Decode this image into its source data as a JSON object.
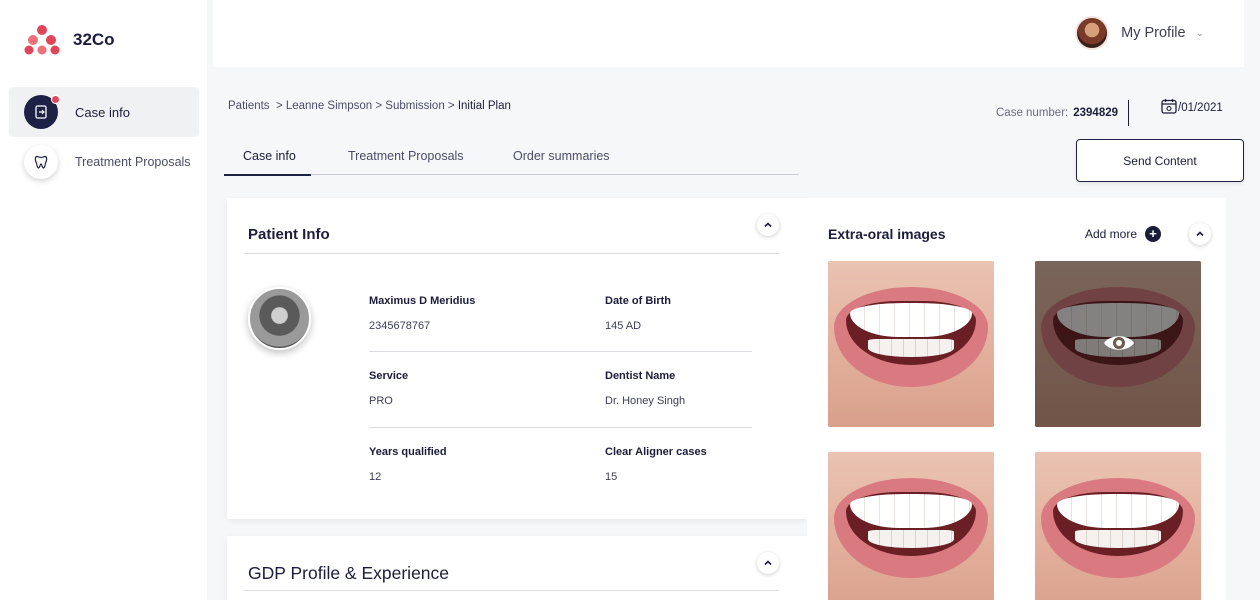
{
  "app": {
    "name": "32Co"
  },
  "sidebar": {
    "items": [
      {
        "label": "Case info",
        "active": true
      },
      {
        "label": "Treatment Proposals",
        "active": false
      }
    ]
  },
  "header": {
    "profile_label": "My Profile"
  },
  "breadcrumb": {
    "path": "Patients  > Leanne Simpson > Submission > ",
    "current": "Initial Plan"
  },
  "case": {
    "number_label": "Case number:",
    "number": "2394829",
    "date": "/01/2021"
  },
  "tabs": [
    {
      "label": "Case info",
      "active": true
    },
    {
      "label": "Treatment Proposals",
      "active": false
    },
    {
      "label": "Order summaries",
      "active": false
    }
  ],
  "send_button": {
    "label": "Send Content"
  },
  "patient_info": {
    "title": "Patient Info",
    "fields": [
      {
        "label": "Maximus D Meridius",
        "value": "2345678767"
      },
      {
        "label": "Date of Birth",
        "value": "145 AD"
      },
      {
        "label": "Service",
        "value": "PRO"
      },
      {
        "label": "Dentist Name",
        "value": "Dr. Honey Singh"
      },
      {
        "label": "Years qualified",
        "value": "12"
      },
      {
        "label": "Clear Aligner cases",
        "value": "15"
      }
    ]
  },
  "gdp_profile": {
    "title": "GDP Profile & Experience"
  },
  "extra_oral": {
    "title": "Extra-oral images",
    "add_more_label": "Add more"
  },
  "colors": {
    "primary": "#1d2145",
    "accent": "#e0455a",
    "background": "#f6f7f9"
  }
}
